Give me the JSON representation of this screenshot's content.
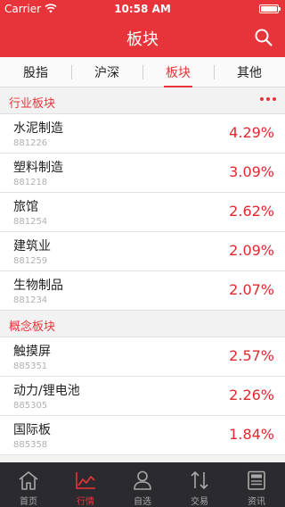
{
  "status_bar": {
    "carrier": "Carrier",
    "time": "10:58 AM"
  },
  "nav": {
    "title": "板块"
  },
  "tabs": [
    {
      "label": "股指",
      "active": false
    },
    {
      "label": "沪深",
      "active": false
    },
    {
      "label": "板块",
      "active": true
    },
    {
      "label": "其他",
      "active": false
    }
  ],
  "sections": [
    {
      "title": "行业板块",
      "items": [
        {
          "name": "水泥制造",
          "code": "881226",
          "change": "4.29%"
        },
        {
          "name": "塑料制造",
          "code": "881218",
          "change": "3.09%"
        },
        {
          "name": "旅馆",
          "code": "881254",
          "change": "2.62%"
        },
        {
          "name": "建筑业",
          "code": "881259",
          "change": "2.09%"
        },
        {
          "name": "生物制品",
          "code": "881234",
          "change": "2.07%"
        }
      ]
    },
    {
      "title": "概念板块",
      "items": [
        {
          "name": "触摸屏",
          "code": "885351",
          "change": "2.57%"
        },
        {
          "name": "动力/锂电池",
          "code": "885305",
          "change": "2.26%"
        },
        {
          "name": "国际板",
          "code": "885358",
          "change": "1.84%"
        }
      ]
    }
  ],
  "tab_bar": [
    {
      "label": "首页",
      "icon": "home-icon",
      "active": false
    },
    {
      "label": "行情",
      "icon": "market-chart-icon",
      "active": true
    },
    {
      "label": "自选",
      "icon": "person-icon",
      "active": false
    },
    {
      "label": "交易",
      "icon": "trade-arrows-icon",
      "active": false
    },
    {
      "label": "资讯",
      "icon": "news-icon",
      "active": false
    }
  ],
  "colors": {
    "brand_red": "#e7343a",
    "rise_red": "#e0282e",
    "tab_bar_bg": "#2b2b2f"
  }
}
